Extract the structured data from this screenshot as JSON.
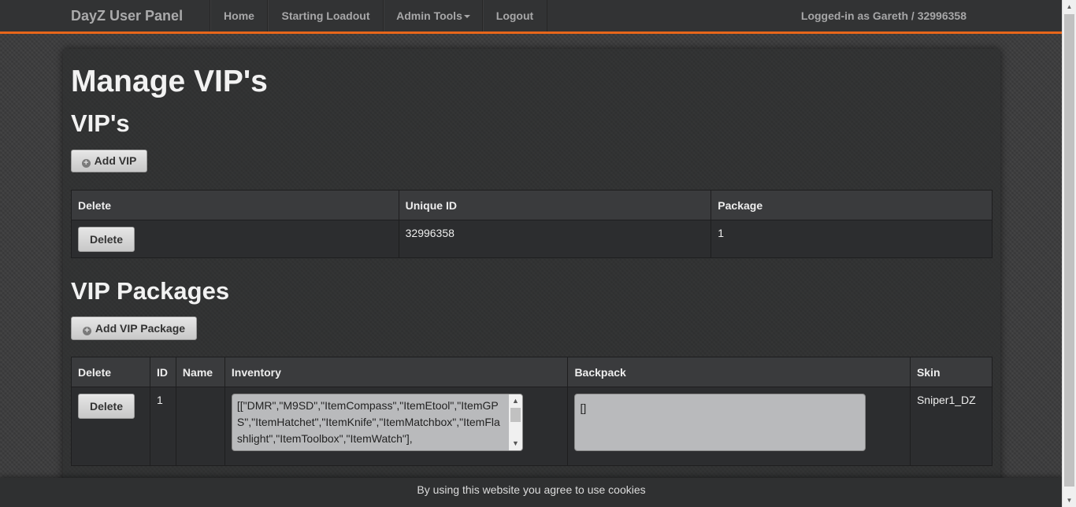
{
  "navbar": {
    "brand": "DayZ User Panel",
    "items": [
      "Home",
      "Starting Loadout",
      "Admin Tools",
      "Logout"
    ],
    "logged_in": "Logged-in as Gareth / 32996358",
    "accent_color": "#e8661a"
  },
  "page": {
    "title": "Manage VIP's",
    "vips_heading": "VIP's",
    "add_vip_label": "Add VIP",
    "vips_table": {
      "headers": [
        "Delete",
        "Unique ID",
        "Package"
      ],
      "rows": [
        {
          "delete_label": "Delete",
          "unique_id": "32996358",
          "package": "1"
        }
      ]
    },
    "packages_heading": "VIP Packages",
    "add_package_label": "Add VIP Package",
    "packages_table": {
      "headers": [
        "Delete",
        "ID",
        "Name",
        "Inventory",
        "Backpack",
        "Skin"
      ],
      "rows": [
        {
          "delete_label": "Delete",
          "id": "1",
          "name": "",
          "inventory": "[[\"DMR\",\"M9SD\",\"ItemCompass\",\"ItemEtool\",\"ItemGPS\",\"ItemHatchet\",\"ItemKnife\",\"ItemMatchbox\",\"ItemFlashlight\",\"ItemToolbox\",\"ItemWatch\"],",
          "backpack": "[]",
          "skin": "Sniper1_DZ"
        }
      ]
    }
  },
  "cookie_notice": "By using this website you agree to use cookies"
}
